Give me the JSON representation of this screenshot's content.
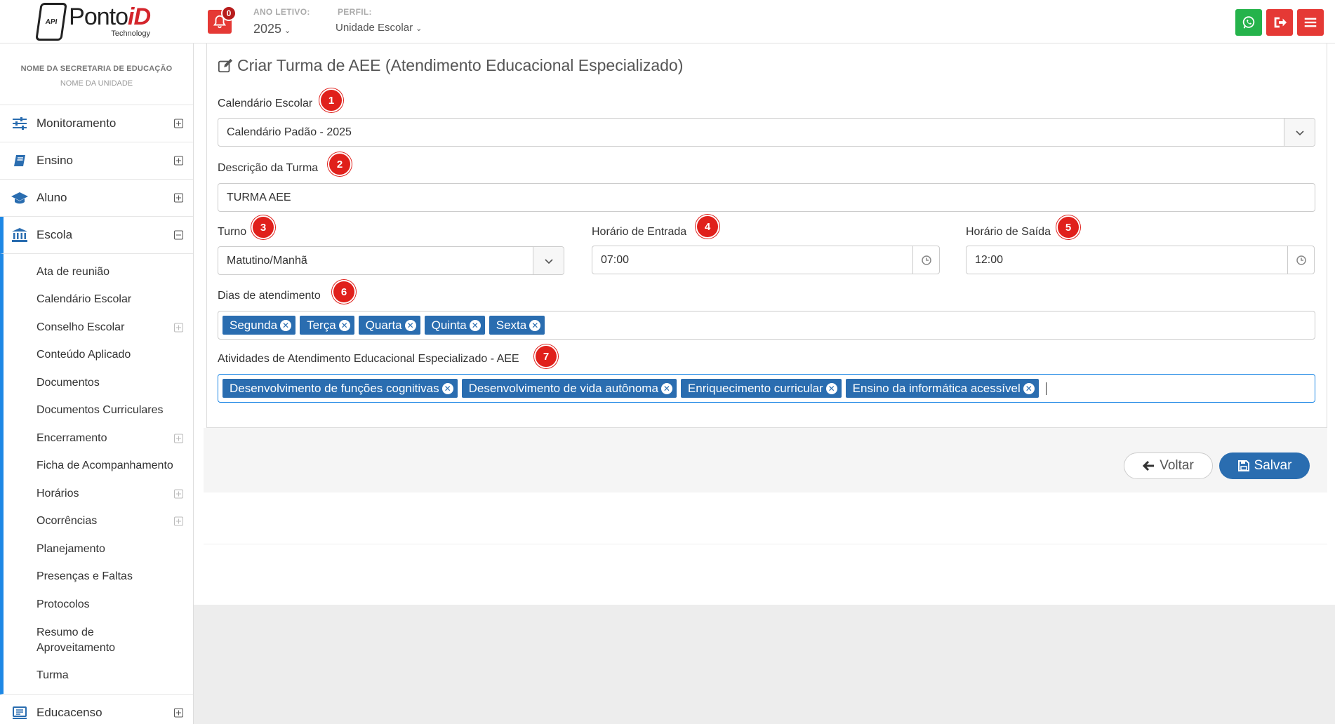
{
  "header": {
    "logo_text": "Ponto",
    "logo_accent": "iD",
    "logo_sub": "Technology",
    "logo_badge": "API",
    "notifications_count": "0",
    "ano_letivo_label": "ANO LETIVO:",
    "ano_letivo_value": "2025",
    "perfil_label": "PERFIL:",
    "perfil_value": "Unidade Escolar"
  },
  "sidebar": {
    "org_name": "NOME DA SECRETARIA DE EDUCAÇÃO",
    "unit_name": "NOME DA UNIDADE",
    "items": [
      {
        "label": "Monitoramento"
      },
      {
        "label": "Ensino"
      },
      {
        "label": "Aluno"
      },
      {
        "label": "Escola"
      }
    ],
    "escola_sub": [
      "Ata de reunião",
      "Calendário Escolar",
      "Conselho Escolar",
      "Conteúdo Aplicado",
      "Documentos",
      "Documentos Curriculares",
      "Encerramento",
      "Ficha de Acompanhamento",
      "Horários",
      "Ocorrências",
      "Planejamento",
      "Presenças e Faltas",
      "Protocolos",
      "Resumo de Aproveitamento",
      "Turma"
    ],
    "educacenso": "Educacenso"
  },
  "form": {
    "title": "Criar Turma de AEE (Atendimento Educacional Especializado)",
    "calendario_label": "Calendário Escolar",
    "calendario_value": "Calendário Padão - 2025",
    "descricao_label": "Descrição da Turma",
    "descricao_value": "TURMA AEE",
    "turno_label": "Turno",
    "turno_value": "Matutino/Manhã",
    "entrada_label": "Horário de Entrada",
    "entrada_value": "07:00",
    "saida_label": "Horário de Saída",
    "saida_value": "12:00",
    "dias_label": "Dias de atendimento",
    "dias": [
      "Segunda",
      "Terça",
      "Quarta",
      "Quinta",
      "Sexta"
    ],
    "atividades_label": "Atividades de Atendimento Educacional Especializado - AEE",
    "atividades": [
      "Desenvolvimento de funções cognitivas",
      "Desenvolvimento de vida autônoma",
      "Enriquecimento curricular",
      "Ensino da informática acessível"
    ],
    "badges": [
      "1",
      "2",
      "3",
      "4",
      "5",
      "6",
      "7"
    ],
    "voltar_label": "Voltar",
    "salvar_label": "Salvar"
  },
  "colors": {
    "primary": "#2a6db0",
    "danger": "#e53935",
    "whatsapp": "#25b34b",
    "badge": "#e0201b"
  }
}
